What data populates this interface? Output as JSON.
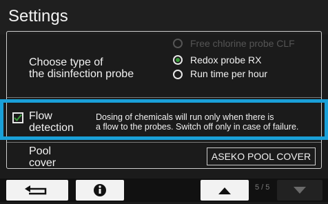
{
  "header": {
    "title": "Settings"
  },
  "disinfection": {
    "label_line1": "Choose type of",
    "label_line2": "the disinfection probe",
    "options": [
      {
        "label": "Free chlorine probe CLF",
        "state": "disabled"
      },
      {
        "label": "Redox probe RX",
        "state": "checked"
      },
      {
        "label": "Run time per hour",
        "state": "unchecked"
      }
    ]
  },
  "flow_detection": {
    "label_line1": "Flow",
    "label_line2": "detection",
    "checked": true,
    "desc_line1": "Dosing of chemicals will run only when there is",
    "desc_line2": "a flow to the probes. Switch off only in case of failure."
  },
  "pool_cover": {
    "label_line1": "Pool",
    "label_line2": "cover",
    "button_label": "ASEKO POOL COVER"
  },
  "footer": {
    "page_indicator": "5 / 5",
    "icons": [
      "back-icon",
      "info-icon",
      "up-arrow-icon",
      "down-arrow-icon"
    ]
  },
  "colors": {
    "highlight": "#1aa0d8",
    "radio_selected": "#3b9d3b"
  }
}
